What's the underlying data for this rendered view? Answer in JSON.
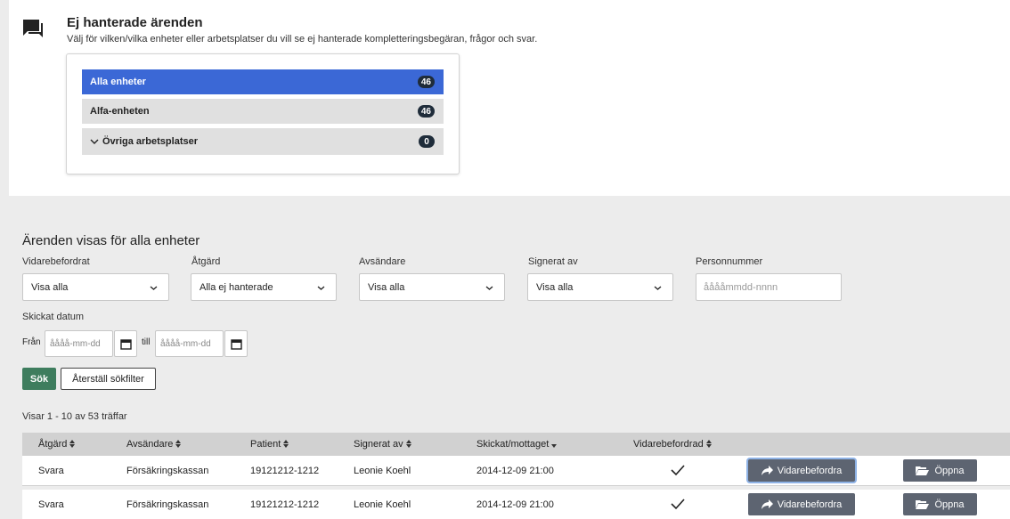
{
  "header": {
    "title": "Ej hanterade ärenden",
    "subtitle": "Välj för vilken/vilka enheter eller arbetsplatser du vill se ej hanterade kompletteringsbegäran, frågor och svar."
  },
  "units": [
    {
      "label": "Alla enheter",
      "count": "46",
      "active": true
    },
    {
      "label": "Alfa-enheten",
      "count": "46",
      "active": false
    },
    {
      "label": "Övriga arbetsplatser",
      "count": "0",
      "active": false
    }
  ],
  "filters": {
    "section_title": "Ärenden visas för alla enheter",
    "forwarded": {
      "label": "Vidarebefordrat",
      "value": "Visa alla"
    },
    "action": {
      "label": "Åtgärd",
      "value": "Alla ej hanterade"
    },
    "sender": {
      "label": "Avsändare",
      "value": "Visa alla"
    },
    "signed_by": {
      "label": "Signerat av",
      "value": "Visa alla"
    },
    "personal_number": {
      "label": "Personnummer",
      "placeholder": "ååååmmdd-nnnn"
    },
    "sent_date": {
      "label": "Skickat datum",
      "from_label": "Från",
      "to_label": "till",
      "from_placeholder": "åååå-mm-dd",
      "to_placeholder": "åååå-mm-dd"
    },
    "search_label": "Sök",
    "reset_label": "Återställ sökfilter"
  },
  "results_text": "Visar 1 - 10 av 53 träffar",
  "table": {
    "columns": [
      "Åtgärd",
      "Avsändare",
      "Patient",
      "Signerat av",
      "Skickat/mottaget",
      "Vidarebefordrad"
    ],
    "forward_label": "Vidarebefordra",
    "open_label": "Öppna",
    "rows": [
      {
        "action": "Svara",
        "sender": "Försäkringskassan",
        "patient": "19121212-1212",
        "signed_by": "Leonie Koehl",
        "sent": "2014-12-09 21:00",
        "forwarded": true
      },
      {
        "action": "Svara",
        "sender": "Försäkringskassan",
        "patient": "19121212-1212",
        "signed_by": "Leonie Koehl",
        "sent": "2014-12-09 21:00",
        "forwarded": true
      }
    ]
  },
  "colors": {
    "accent": "#3b68d6",
    "search_button": "#3e7d5e",
    "action_button": "#5d6471",
    "badge": "#1f2c3a"
  }
}
